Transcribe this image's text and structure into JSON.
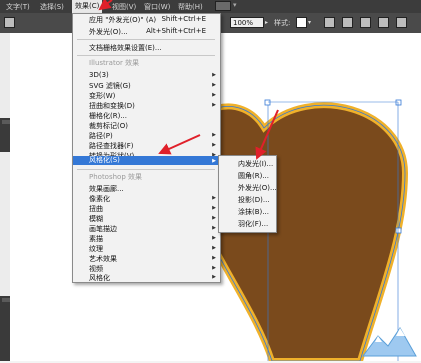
{
  "menubar": {
    "items": [
      "文字(T)",
      "选择(S)",
      "效果(C)",
      "视图(V)",
      "窗口(W)",
      "帮助(H)"
    ]
  },
  "toolbar": {
    "zoom": "100%",
    "style_label": "样式:"
  },
  "effect_menu": {
    "apply_last_label": "应用 \"外发光(O)\" (A)",
    "apply_last_shortcut": "Shift+Ctrl+E",
    "last_effect_label": "外发光(O)...",
    "last_effect_shortcut": "Alt+Shift+Ctrl+E",
    "raster_settings": "文档栅格效果设置(E)...",
    "illustrator_header": "Illustrator 效果",
    "illustrator_items": [
      "3D(3)",
      "SVG 滤镜(G)",
      "变形(W)",
      "扭曲和变换(D)",
      "栅格化(R)...",
      "裁剪标记(O)",
      "路径(P)",
      "路径查找器(F)",
      "转换为形状(V)",
      "风格化(S)"
    ],
    "photoshop_header": "Photoshop 效果",
    "photoshop_items": [
      "效果画廊...",
      "像素化",
      "扭曲",
      "模糊",
      "画笔描边",
      "素描",
      "纹理",
      "艺术效果",
      "视频",
      "风格化"
    ]
  },
  "stylize_submenu": {
    "items": [
      "内发光(I)...",
      "圆角(R)...",
      "外发光(O)...",
      "投影(D)...",
      "涂抹(B)...",
      "羽化(F)..."
    ]
  },
  "colors": {
    "highlight": "#3478d6",
    "heart_fill": "#7a4a1c",
    "heart_stroke": "#f0b12a",
    "annotation": "#e0202a"
  }
}
